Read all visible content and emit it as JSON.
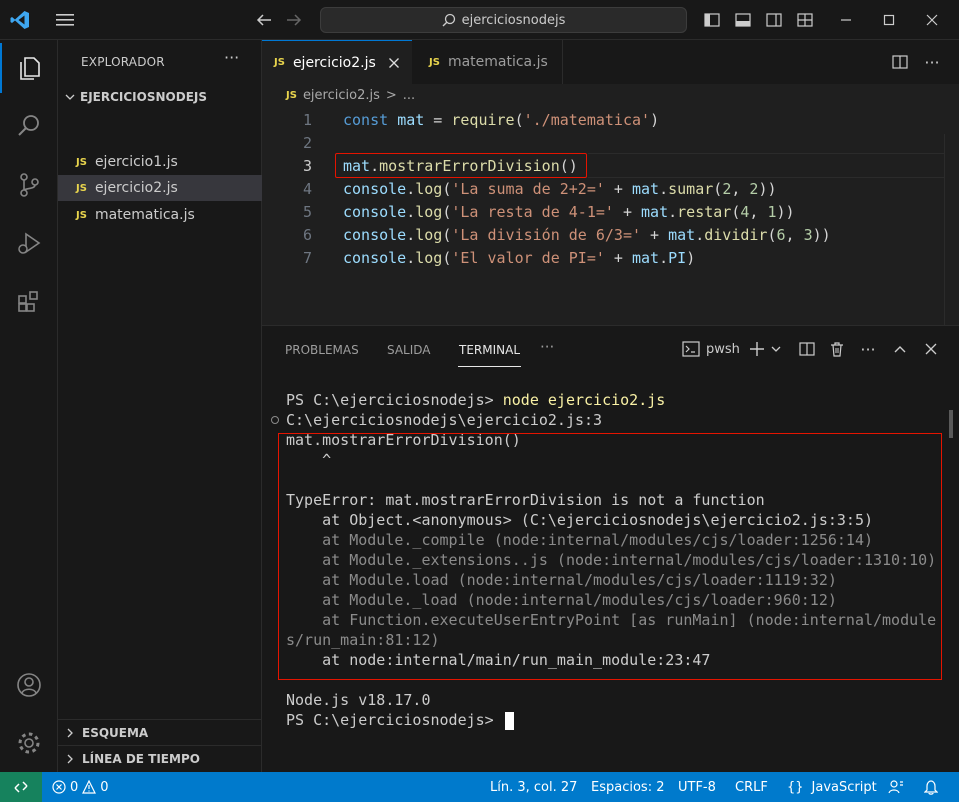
{
  "titlebar": {
    "search_text": "ejerciciosnodejs"
  },
  "sidebar": {
    "title": "EXPLORADOR",
    "folder": "EJERCICIOSNODEJS",
    "files": [
      {
        "badge": "JS",
        "name": "ejercicio1.js"
      },
      {
        "badge": "JS",
        "name": "ejercicio2.js"
      },
      {
        "badge": "JS",
        "name": "matematica.js"
      }
    ],
    "outline": "ESQUEMA",
    "timeline": "LÍNEA DE TIEMPO"
  },
  "editor": {
    "tabs": [
      {
        "badge": "JS",
        "name": "ejercicio2.js"
      },
      {
        "badge": "JS",
        "name": "matematica.js"
      }
    ],
    "breadcrumb": {
      "badge": "JS",
      "file": "ejercicio2.js",
      "sep": ">",
      "more": "..."
    },
    "line_numbers": [
      "1",
      "2",
      "3",
      "4",
      "5",
      "6",
      "7"
    ],
    "lines": [
      [
        {
          "t": "k",
          "v": "const"
        },
        {
          "t": "p",
          "v": " "
        },
        {
          "t": "v",
          "v": "mat"
        },
        {
          "t": "p",
          "v": " = "
        },
        {
          "t": "f",
          "v": "require"
        },
        {
          "t": "p",
          "v": "("
        },
        {
          "t": "s",
          "v": "'./matematica'"
        },
        {
          "t": "p",
          "v": ")"
        }
      ],
      [],
      [
        {
          "t": "v",
          "v": "mat"
        },
        {
          "t": "p",
          "v": "."
        },
        {
          "t": "f",
          "v": "mostrarErrorDivision"
        },
        {
          "t": "p",
          "v": "()"
        }
      ],
      [
        {
          "t": "v",
          "v": "console"
        },
        {
          "t": "p",
          "v": "."
        },
        {
          "t": "f",
          "v": "log"
        },
        {
          "t": "p",
          "v": "("
        },
        {
          "t": "s",
          "v": "'La suma de 2+2='"
        },
        {
          "t": "p",
          "v": " + "
        },
        {
          "t": "v",
          "v": "mat"
        },
        {
          "t": "p",
          "v": "."
        },
        {
          "t": "f",
          "v": "sumar"
        },
        {
          "t": "p",
          "v": "("
        },
        {
          "t": "n",
          "v": "2"
        },
        {
          "t": "p",
          "v": ", "
        },
        {
          "t": "n",
          "v": "2"
        },
        {
          "t": "p",
          "v": "))"
        }
      ],
      [
        {
          "t": "v",
          "v": "console"
        },
        {
          "t": "p",
          "v": "."
        },
        {
          "t": "f",
          "v": "log"
        },
        {
          "t": "p",
          "v": "("
        },
        {
          "t": "s",
          "v": "'La resta de 4-1='"
        },
        {
          "t": "p",
          "v": " + "
        },
        {
          "t": "v",
          "v": "mat"
        },
        {
          "t": "p",
          "v": "."
        },
        {
          "t": "f",
          "v": "restar"
        },
        {
          "t": "p",
          "v": "("
        },
        {
          "t": "n",
          "v": "4"
        },
        {
          "t": "p",
          "v": ", "
        },
        {
          "t": "n",
          "v": "1"
        },
        {
          "t": "p",
          "v": "))"
        }
      ],
      [
        {
          "t": "v",
          "v": "console"
        },
        {
          "t": "p",
          "v": "."
        },
        {
          "t": "f",
          "v": "log"
        },
        {
          "t": "p",
          "v": "("
        },
        {
          "t": "s",
          "v": "'La división de 6/3='"
        },
        {
          "t": "p",
          "v": " + "
        },
        {
          "t": "v",
          "v": "mat"
        },
        {
          "t": "p",
          "v": "."
        },
        {
          "t": "f",
          "v": "dividir"
        },
        {
          "t": "p",
          "v": "("
        },
        {
          "t": "n",
          "v": "6"
        },
        {
          "t": "p",
          "v": ", "
        },
        {
          "t": "n",
          "v": "3"
        },
        {
          "t": "p",
          "v": "))"
        }
      ],
      [
        {
          "t": "v",
          "v": "console"
        },
        {
          "t": "p",
          "v": "."
        },
        {
          "t": "f",
          "v": "log"
        },
        {
          "t": "p",
          "v": "("
        },
        {
          "t": "s",
          "v": "'El valor de PI='"
        },
        {
          "t": "p",
          "v": " + "
        },
        {
          "t": "v",
          "v": "mat"
        },
        {
          "t": "p",
          "v": "."
        },
        {
          "t": "v",
          "v": "PI"
        },
        {
          "t": "p",
          "v": ")"
        }
      ]
    ]
  },
  "panel": {
    "tabs": [
      "PROBLEMAS",
      "SALIDA",
      "TERMINAL"
    ],
    "more": "···",
    "shell": "pwsh",
    "terminal": {
      "prompt1": "PS C:\\ejerciciosnodejs> ",
      "command": "node ejercicio2.js",
      "lines": [
        "C:\\ejerciciosnodejs\\ejercicio2.js:3",
        "mat.mostrarErrorDivision()",
        "    ^",
        "",
        "TypeError: mat.mostrarErrorDivision is not a function",
        "    at Object.<anonymous> (C:\\ejerciciosnodejs\\ejercicio2.js:3:5)",
        "    at Module._compile (node:internal/modules/cjs/loader:1256:14)",
        "    at Module._extensions..js (node:internal/modules/cjs/loader:1310:10)",
        "    at Module.load (node:internal/modules/cjs/loader:1119:32)",
        "    at Module._load (node:internal/modules/cjs/loader:960:12)",
        "    at Function.executeUserEntryPoint [as runMain] (node:internal/module",
        "s/run_main:81:12)",
        "    at node:internal/main/run_main_module:23:47",
        "",
        "Node.js v18.17.0"
      ],
      "prompt2": "PS C:\\ejerciciosnodejs> "
    }
  },
  "statusbar": {
    "errors": "0",
    "warnings": "0",
    "position": "Lín. 3, col. 27",
    "spaces": "Espacios: 2",
    "encoding": "UTF-8",
    "eol": "CRLF",
    "language_glyph": "{}",
    "language": "JavaScript"
  },
  "colors": {
    "accent": "#0078d4",
    "statusbar": "#007acc",
    "remote": "#16825d",
    "error_box": "#e51400"
  }
}
